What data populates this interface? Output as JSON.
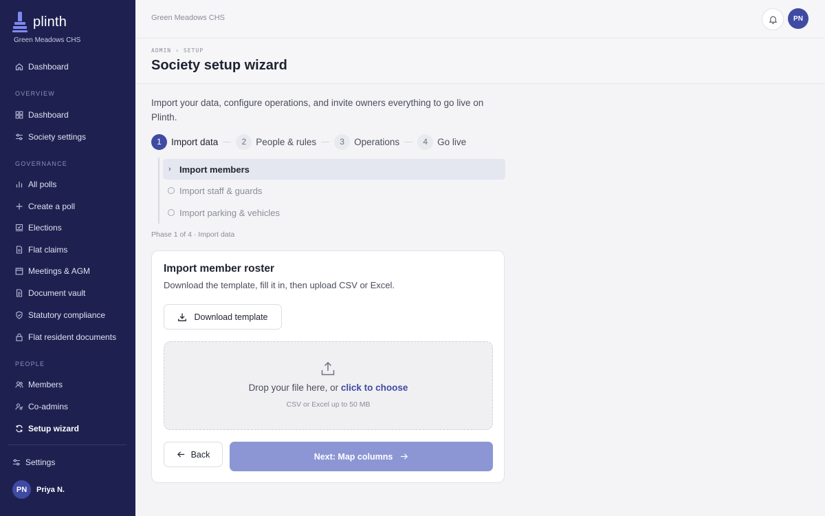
{
  "brand": {
    "name": "plinth",
    "society": "Green Meadows CHS"
  },
  "sidebar": {
    "top_item": {
      "label": "Dashboard",
      "icon": "home-icon"
    },
    "sections": [
      {
        "title": "OVERVIEW",
        "items": [
          {
            "label": "Dashboard",
            "icon": "grid-icon"
          },
          {
            "label": "Society settings",
            "icon": "sliders-icon"
          }
        ]
      },
      {
        "title": "GOVERNANCE",
        "items": [
          {
            "label": "All polls",
            "icon": "bar-chart-icon"
          },
          {
            "label": "Create a poll",
            "icon": "plus-icon"
          },
          {
            "label": "Elections",
            "icon": "ballot-icon"
          },
          {
            "label": "Flat claims",
            "icon": "file-icon"
          },
          {
            "label": "Meetings & AGM",
            "icon": "calendar-icon"
          },
          {
            "label": "Document vault",
            "icon": "document-icon"
          },
          {
            "label": "Statutory compliance",
            "icon": "shield-icon"
          },
          {
            "label": "Flat resident documents",
            "icon": "lock-icon"
          }
        ]
      },
      {
        "title": "PEOPLE",
        "items": [
          {
            "label": "Members",
            "icon": "users-icon"
          },
          {
            "label": "Co-admins",
            "icon": "user-key-icon"
          },
          {
            "label": "Setup wizard",
            "icon": "refresh-icon",
            "active": true
          }
        ]
      }
    ],
    "settings_label": "Settings",
    "user": {
      "initials": "PN",
      "name": "Priya N."
    }
  },
  "topbar": {
    "title": "Green Meadows CHS",
    "avatar_initials": "PN"
  },
  "header": {
    "breadcrumb": [
      "ADMIN",
      "SETUP"
    ],
    "title": "Society setup wizard"
  },
  "intro": "Import your data, configure operations, and invite owners everything to go live on Plinth.",
  "stepper": [
    {
      "num": "1",
      "label": "Import data",
      "active": true
    },
    {
      "num": "2",
      "label": "People & rules"
    },
    {
      "num": "3",
      "label": "Operations"
    },
    {
      "num": "4",
      "label": "Go live"
    }
  ],
  "substeps": [
    {
      "label": "Import members",
      "active": true
    },
    {
      "label": "Import staff & guards"
    },
    {
      "label": "Import parking & vehicles"
    }
  ],
  "phase_note": "Phase 1 of 4 · Import data",
  "card": {
    "title": "Import member roster",
    "desc": "Download the template, fill it in, then upload CSV or Excel.",
    "download_label": "Download template",
    "drop_text": "Drop your file here, or",
    "drop_link": "click to choose",
    "drop_hint": "CSV or Excel up to 50 MB",
    "back_label": "Back",
    "next_label": "Next: Map columns"
  },
  "colors": {
    "sidebar_bg": "#1e2150",
    "accent": "#3f4aa3",
    "next_button": "#8c96d4"
  }
}
